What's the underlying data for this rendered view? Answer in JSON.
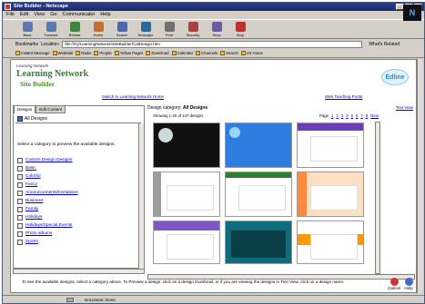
{
  "window": {
    "title": "Site Builder - Netscape"
  },
  "menu": [
    "File",
    "Edit",
    "View",
    "Go",
    "Communicator",
    "Help"
  ],
  "nav": [
    {
      "label": "Back",
      "color": "#5a7ab0"
    },
    {
      "label": "Forward",
      "color": "#5a7ab0"
    },
    {
      "label": "Reload",
      "color": "#3a8a3a"
    },
    {
      "label": "Home",
      "color": "#c07030"
    },
    {
      "label": "Search",
      "color": "#4a6ab0"
    },
    {
      "label": "Netscape",
      "color": "#2a6a9a"
    },
    {
      "label": "Print",
      "color": "#707070"
    },
    {
      "label": "Security",
      "color": "#b04040"
    },
    {
      "label": "Shop",
      "color": "#6a5aa0"
    },
    {
      "label": "Stop",
      "color": "#c03030"
    }
  ],
  "location": {
    "bookmarks_label": "Bookmarks",
    "location_label": "Location:",
    "url": "file:///C|/LearningNetwork/SiteBuilder/CatDesign.htm",
    "related_label": "What's Related"
  },
  "personal_toolbar": [
    "Instant Message",
    "WebMail",
    "Radio",
    "People",
    "Yellow Pages",
    "Download",
    "Calendar",
    "Channels",
    "Search",
    "LN Home"
  ],
  "header": {
    "brand_top": "Learning Network",
    "brand_name": "Learning Network",
    "brand_sub": "Site Builder",
    "partner_logo": "Edline",
    "link_left": "Switch to Learning Network Home",
    "link_right": "Web Teaching Portal"
  },
  "left": {
    "tab_designs": "Designs",
    "tab_edit": "Edit Content",
    "all_designs": "All Designs",
    "prompt": "Select a category to preview the available designs.",
    "categories": [
      "Custom Design Designs",
      "Basic",
      "Colorful",
      "Fancy",
      "Announcements/Invitations",
      "Business",
      "Family",
      "Holidays",
      "Holidays/Special Events",
      "Photo albums",
      "Sports"
    ]
  },
  "right": {
    "category_label": "Design category:",
    "category_value": "All Designs",
    "text_view": "Text View",
    "showing": "Showing 1-20 of 147 designs",
    "pages_label": "Page",
    "pages": [
      "1",
      "2",
      "3",
      "4",
      "5",
      "6",
      "7",
      "8",
      "Next"
    ]
  },
  "thumbs": [
    {
      "name": "dark-dots",
      "bg": "#111111",
      "accent": "#cfd8dc"
    },
    {
      "name": "blue-circles",
      "bg": "#2f7de0",
      "accent": "#9ad3ff"
    },
    {
      "name": "purple-frame",
      "bg": "#ffffff",
      "accent": "#6a3fb5"
    },
    {
      "name": "gray-border",
      "bg": "#ffffff",
      "accent": "#9e9e9e"
    },
    {
      "name": "green-frame",
      "bg": "#ffffff",
      "accent": "#2e7d32"
    },
    {
      "name": "orange-peach",
      "bg": "#ffe0c2",
      "accent": "#ff8a3d"
    },
    {
      "name": "purple-wave",
      "bg": "#ffffff",
      "accent": "#7e57c2"
    },
    {
      "name": "teal-block",
      "bg": "#0d6d7a",
      "accent": "#0a3f47"
    },
    {
      "name": "orange-red",
      "bg": "#ffffff",
      "accent": "#ff9800"
    }
  ],
  "footer": {
    "info": "To see the available designs, select a category above. To Preview a design, click on a design thumbnail, or if you are viewing the designs in Text View, click on a design name.",
    "cancel": "Cancel",
    "help": "Help"
  },
  "status": {
    "text": "Document: Done"
  }
}
